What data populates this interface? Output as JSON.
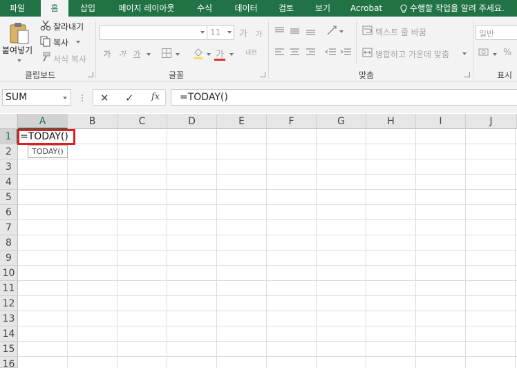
{
  "ribbon_tabs": [
    {
      "label": "파일"
    },
    {
      "label": "홈"
    },
    {
      "label": "삽입"
    },
    {
      "label": "페이지 레이아웃"
    },
    {
      "label": "수식"
    },
    {
      "label": "데이터"
    },
    {
      "label": "검토"
    },
    {
      "label": "보기"
    },
    {
      "label": "Acrobat"
    }
  ],
  "active_tab": "홈",
  "tell_me": "수행할 작업을 알려 주세요.",
  "clipboard": {
    "paste": "붙여넣기",
    "cut": "잘라내기",
    "copy": "복사",
    "format_painter": "서식 복사",
    "group_label": "클립보드"
  },
  "font": {
    "font_name": "",
    "font_size": "11",
    "grow": "가",
    "shrink": "가",
    "bold": "가",
    "italic": "가",
    "underline": "가",
    "font_color": "가",
    "phonetic": "내천",
    "group_label": "글꼴"
  },
  "alignment": {
    "wrap_text": "텍스트 줄 바꿈",
    "merge_center": "병합하고 가운데 맞춤",
    "group_label": "맞춤"
  },
  "number": {
    "format": "일반",
    "percent": "%",
    "group_label": "표시"
  },
  "formula_bar": {
    "name_box": "SUM",
    "cancel": "✕",
    "enter": "✓",
    "fx": "fx",
    "content": "=TODAY()"
  },
  "grid": {
    "columns": [
      "A",
      "B",
      "C",
      "D",
      "E",
      "F",
      "G",
      "H",
      "I",
      "J"
    ],
    "rows": [
      "1",
      "2",
      "3",
      "4",
      "5",
      "6",
      "7",
      "8",
      "9",
      "10",
      "11",
      "12",
      "13",
      "14",
      "15",
      "16"
    ],
    "active_cell_text": "=TODAY()",
    "tooltip": "TODAY()"
  },
  "colors": {
    "accent": "#217346",
    "highlight": "#e21d22"
  }
}
